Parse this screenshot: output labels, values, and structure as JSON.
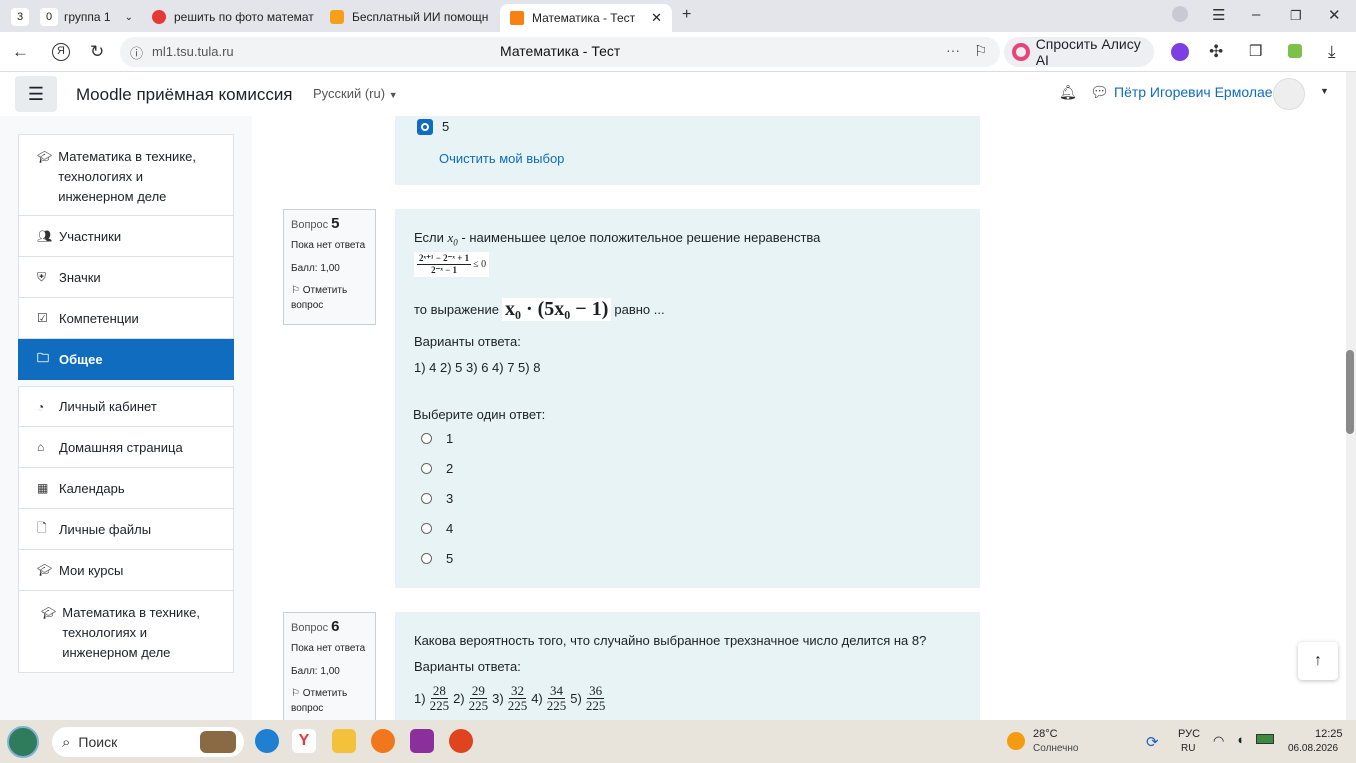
{
  "browser": {
    "tabs": [
      {
        "count": "3",
        "label": ""
      },
      {
        "count": "0",
        "label": "группа 1"
      },
      {
        "label": "решить по фото математ"
      },
      {
        "label": "Бесплатный ИИ помощн"
      },
      {
        "label": "Математика - Тест"
      }
    ],
    "url": "ml1.tsu.tula.ru",
    "page_title": "Математика - Тест",
    "alice_label": "Спросить Алису AI"
  },
  "header": {
    "brand": "Moodle приёмная комиссия",
    "language": "Русский (ru)",
    "user_name": "Пётр Игоревич Ермолаев"
  },
  "drawer": {
    "items": [
      {
        "label": "Математика в технике, технологиях и инженерном деле",
        "icon": "graduation-cap-icon"
      },
      {
        "label": "Участники",
        "icon": "users-icon"
      },
      {
        "label": "Значки",
        "icon": "shield-icon"
      },
      {
        "label": "Компетенции",
        "icon": "checkbox-icon"
      },
      {
        "label": "Общее",
        "icon": "folder-icon",
        "selected": true
      },
      {
        "label": "Личный кабинет",
        "icon": "dashboard-icon"
      },
      {
        "label": "Домашняя страница",
        "icon": "home-icon"
      },
      {
        "label": "Календарь",
        "icon": "calendar-icon"
      },
      {
        "label": "Личные файлы",
        "icon": "file-icon"
      },
      {
        "label": "Мои курсы",
        "icon": "graduation-cap-icon"
      },
      {
        "label": "Математика в технике, технологиях и инженерном деле",
        "icon": "graduation-cap-icon"
      }
    ]
  },
  "prev_question": {
    "selected_option": "5",
    "clear_label": "Очистить мой выбор"
  },
  "question5": {
    "label": "Вопрос",
    "number": "5",
    "status": "Пока нет ответа",
    "grade": "Балл: 1,00",
    "flag": "Отметить вопрос",
    "text_before": "Если",
    "var": "x",
    "sub": "0",
    "text_after": "- наименьшее целое положительное решение неравенства",
    "ineq_num": "2ˣ⁺¹ − 2⁻ˣ + 1",
    "ineq_den": "2⁻ˣ − 1",
    "ineq_rel": "≤ 0",
    "expr_prefix": "то выражение",
    "expr": "x₀ · (5x₀ − 1)",
    "expr_suffix": "равно ...",
    "variants_label": "Варианты ответа:",
    "variants": "1) 4 2) 5 3) 6 4) 7 5) 8",
    "prompt": "Выберите один ответ:",
    "options": [
      "1",
      "2",
      "3",
      "4",
      "5"
    ]
  },
  "question6": {
    "label": "Вопрос",
    "number": "6",
    "status": "Пока нет ответа",
    "grade": "Балл: 1,00",
    "flag": "Отметить вопрос",
    "text": "Какова вероятность того, что случайно выбранное трехзначное число делится на 8?",
    "variants_label": "Варианты ответа:",
    "fractions": [
      {
        "tag": "1)",
        "num": "28",
        "den": "225"
      },
      {
        "tag": "2)",
        "num": "29",
        "den": "225"
      },
      {
        "tag": "3)",
        "num": "32",
        "den": "225"
      },
      {
        "tag": "4)",
        "num": "34",
        "den": "225"
      },
      {
        "tag": "5)",
        "num": "36",
        "den": "225"
      }
    ]
  },
  "taskbar": {
    "search_label": "Поиск",
    "weather_temp": "28°C",
    "weather_desc": "Солнечно",
    "lang_top": "РУС",
    "lang_bottom": "RU",
    "time": "12:25",
    "date": "06.08.2026"
  }
}
